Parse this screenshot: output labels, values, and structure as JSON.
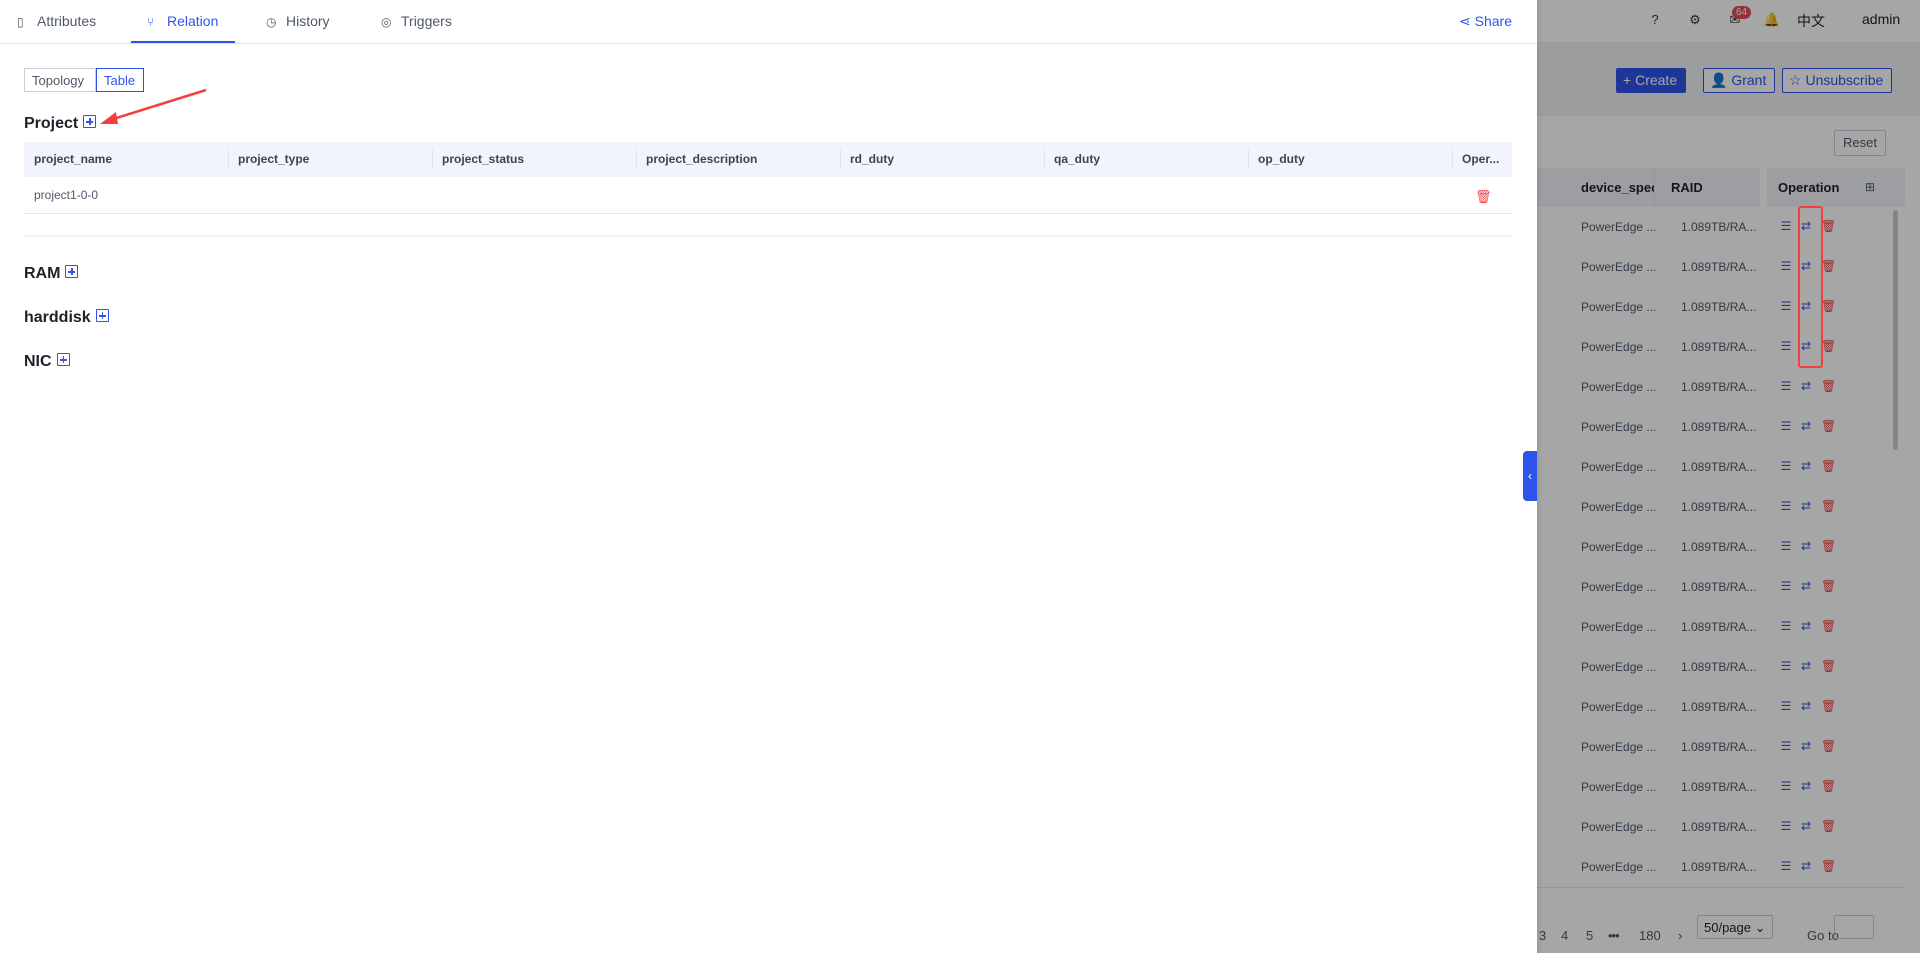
{
  "topbar": {
    "notification_count": "64",
    "language": "中文",
    "user": "admin"
  },
  "background": {
    "actions": {
      "create": "Create",
      "grant": "Grant",
      "unsubscribe": "Unsubscribe"
    },
    "reset": "Reset",
    "columns": [
      "device_spec",
      "RAID",
      "Operation"
    ],
    "row_values": {
      "device_spec": "PowerEdge ...",
      "raid": "1.089TB/RA..."
    },
    "row_count_visible": 17,
    "pagination": {
      "pages": [
        "3",
        "4",
        "5",
        "•••",
        "180"
      ],
      "page_size": "50/page",
      "goto_label": "Go to"
    }
  },
  "drawer": {
    "tabs": [
      {
        "label": "Attributes",
        "icon": "document-icon"
      },
      {
        "label": "Relation",
        "icon": "branch-icon",
        "active": true
      },
      {
        "label": "History",
        "icon": "clock-icon"
      },
      {
        "label": "Triggers",
        "icon": "trigger-icon"
      }
    ],
    "share_label": "Share",
    "view_modes": {
      "topology": "Topology",
      "table": "Table",
      "selected": "Table"
    },
    "sections": [
      {
        "title": "Project",
        "columns": [
          "project_name",
          "project_type",
          "project_status",
          "project_description",
          "rd_duty",
          "qa_duty",
          "op_duty",
          "Oper..."
        ],
        "rows": [
          {
            "project_name": "project1-0-0"
          }
        ]
      },
      {
        "title": "RAM"
      },
      {
        "title": "harddisk"
      },
      {
        "title": "NIC"
      }
    ]
  },
  "colors": {
    "accent": "#2f54eb",
    "danger": "#f53f3f",
    "header_bg": "#f2f4fc"
  }
}
